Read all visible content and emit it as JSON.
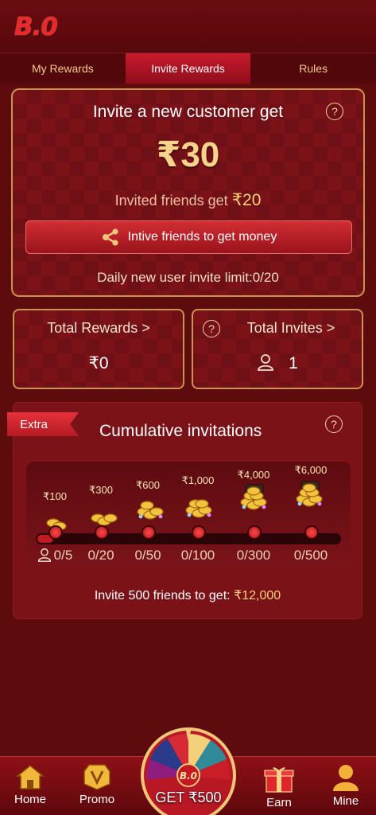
{
  "header": {
    "logo_text": "B.0"
  },
  "tabs": [
    {
      "label": "My Rewards",
      "active": false
    },
    {
      "label": "Invite Rewards",
      "active": true
    },
    {
      "label": "Rules",
      "active": false
    }
  ],
  "invite": {
    "title": "Invite a new customer get",
    "amount": "₹30",
    "invited_prefix": "Invited friends get",
    "invited_amount": "₹20",
    "button_label": "Intive friends to get money",
    "daily_limit": "Daily new user invite limit:0/20",
    "help": "?"
  },
  "stats": {
    "total_rewards_label": "Total Rewards >",
    "total_rewards_value": "₹0",
    "total_invites_label": "Total Invites >",
    "total_invites_value": "1",
    "help": "?"
  },
  "cumulative": {
    "badge": "Extra",
    "title": "Cumulative invitations",
    "help": "?",
    "tiers": [
      {
        "reward": "₹100",
        "count": "0/5"
      },
      {
        "reward": "₹300",
        "count": "0/20"
      },
      {
        "reward": "₹600",
        "count": "0/50"
      },
      {
        "reward": "₹1,000",
        "count": "0/100"
      },
      {
        "reward": "₹4,000",
        "count": "0/300"
      },
      {
        "reward": "₹6,000",
        "count": "0/500"
      }
    ],
    "goal_prefix": "Invite 500 friends to get:",
    "goal_amount": "₹12,000"
  },
  "nav": {
    "home": "Home",
    "promo": "Promo",
    "wheel": "GET ₹500",
    "wheel_badge": "B.0",
    "earn": "Earn",
    "mine": "Mine"
  },
  "colors": {
    "background": "#5e0b0e",
    "accent_gold": "#f7d48a",
    "card_border": "#c9954e",
    "active_tab": "#c81a2c"
  }
}
